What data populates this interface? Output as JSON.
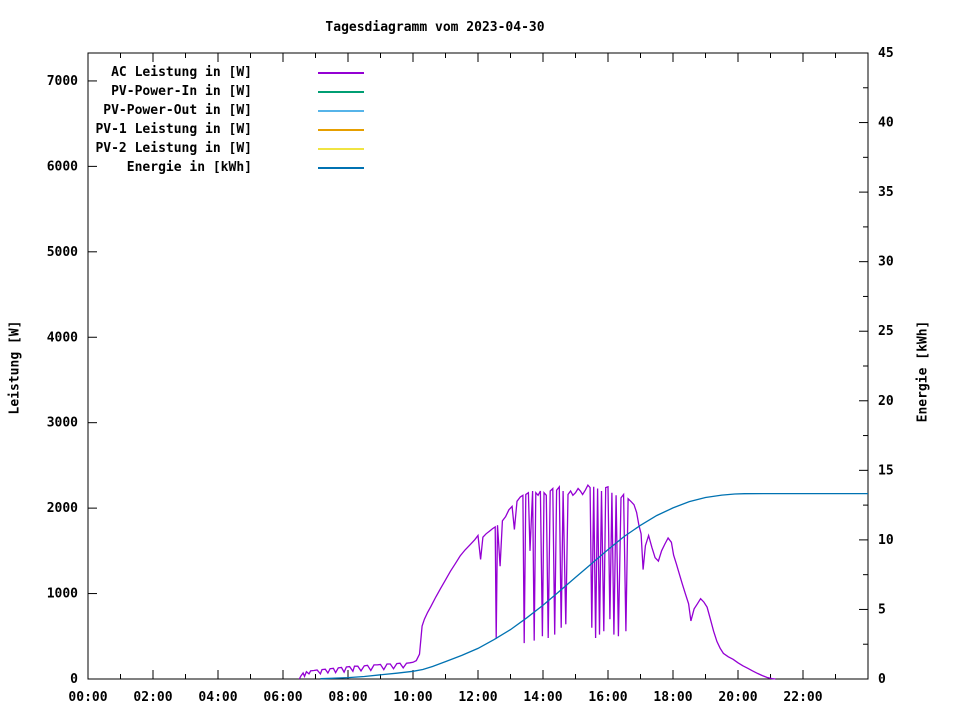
{
  "chart_data": {
    "type": "line",
    "title": "Tagesdiagramm vom 2023-04-30",
    "xlabel": "",
    "ylabel_left": "Leistung [W]",
    "ylabel_right": "Energie [kWh]",
    "legend_position": "top-left-inside",
    "grid": false,
    "x_axis": {
      "min_hours": 0,
      "max_hours": 24,
      "major_step_hours": 2,
      "minor_step_hours": 1,
      "tick_labels": [
        "00:00",
        "02:00",
        "04:00",
        "06:00",
        "08:00",
        "10:00",
        "12:00",
        "14:00",
        "16:00",
        "18:00",
        "20:00",
        "22:00"
      ]
    },
    "y_left_axis": {
      "min": 0,
      "max": 7327,
      "tick_step": 1000,
      "tick_labels": [
        "0",
        "1000",
        "2000",
        "3000",
        "4000",
        "5000",
        "6000",
        "7000"
      ]
    },
    "y_right_axis": {
      "min": 0,
      "max": 45,
      "major_step": 5,
      "minor_step": 2.5,
      "tick_labels": [
        "0",
        "5",
        "10",
        "15",
        "20",
        "25",
        "30",
        "35",
        "40",
        "45"
      ]
    },
    "series": [
      {
        "name": "AC Leistung in [W]",
        "color": "#9400D3",
        "axis": "left",
        "points": [
          [
            6.5,
            0
          ],
          [
            6.55,
            35
          ],
          [
            6.62,
            70
          ],
          [
            6.66,
            30
          ],
          [
            6.72,
            85
          ],
          [
            6.8,
            60
          ],
          [
            6.85,
            95
          ],
          [
            6.95,
            100
          ],
          [
            7.05,
            105
          ],
          [
            7.15,
            60
          ],
          [
            7.2,
            110
          ],
          [
            7.3,
            115
          ],
          [
            7.38,
            70
          ],
          [
            7.45,
            120
          ],
          [
            7.55,
            125
          ],
          [
            7.62,
            75
          ],
          [
            7.7,
            130
          ],
          [
            7.8,
            135
          ],
          [
            7.88,
            80
          ],
          [
            7.95,
            140
          ],
          [
            8.05,
            145
          ],
          [
            8.15,
            90
          ],
          [
            8.2,
            150
          ],
          [
            8.3,
            150
          ],
          [
            8.4,
            95
          ],
          [
            8.5,
            155
          ],
          [
            8.6,
            160
          ],
          [
            8.7,
            100
          ],
          [
            8.8,
            165
          ],
          [
            8.9,
            165
          ],
          [
            9.0,
            170
          ],
          [
            9.1,
            110
          ],
          [
            9.2,
            175
          ],
          [
            9.3,
            175
          ],
          [
            9.4,
            120
          ],
          [
            9.5,
            180
          ],
          [
            9.6,
            185
          ],
          [
            9.7,
            130
          ],
          [
            9.8,
            185
          ],
          [
            9.9,
            190
          ],
          [
            10.0,
            195
          ],
          [
            10.1,
            215
          ],
          [
            10.2,
            290
          ],
          [
            10.28,
            620
          ],
          [
            10.35,
            700
          ],
          [
            10.45,
            780
          ],
          [
            10.55,
            850
          ],
          [
            10.7,
            960
          ],
          [
            10.85,
            1060
          ],
          [
            11.0,
            1160
          ],
          [
            11.15,
            1260
          ],
          [
            11.3,
            1350
          ],
          [
            11.45,
            1440
          ],
          [
            11.6,
            1510
          ],
          [
            11.75,
            1570
          ],
          [
            11.9,
            1630
          ],
          [
            12.0,
            1680
          ],
          [
            12.08,
            1400
          ],
          [
            12.15,
            1660
          ],
          [
            12.25,
            1700
          ],
          [
            12.35,
            1730
          ],
          [
            12.45,
            1760
          ],
          [
            12.53,
            1780
          ],
          [
            12.56,
            470
          ],
          [
            12.6,
            1800
          ],
          [
            12.68,
            1320
          ],
          [
            12.75,
            1850
          ],
          [
            12.85,
            1900
          ],
          [
            12.95,
            1980
          ],
          [
            13.05,
            2020
          ],
          [
            13.12,
            1750
          ],
          [
            13.2,
            2080
          ],
          [
            13.3,
            2130
          ],
          [
            13.38,
            2150
          ],
          [
            13.42,
            420
          ],
          [
            13.47,
            2160
          ],
          [
            13.55,
            2180
          ],
          [
            13.6,
            1500
          ],
          [
            13.68,
            2200
          ],
          [
            13.73,
            450
          ],
          [
            13.78,
            2180
          ],
          [
            13.85,
            2150
          ],
          [
            13.92,
            2200
          ],
          [
            13.98,
            500
          ],
          [
            14.03,
            2180
          ],
          [
            14.1,
            2150
          ],
          [
            14.16,
            480
          ],
          [
            14.22,
            2200
          ],
          [
            14.3,
            2230
          ],
          [
            14.36,
            520
          ],
          [
            14.42,
            2210
          ],
          [
            14.5,
            2250
          ],
          [
            14.56,
            600
          ],
          [
            14.62,
            2200
          ],
          [
            14.7,
            640
          ],
          [
            14.77,
            2160
          ],
          [
            14.85,
            2200
          ],
          [
            14.92,
            2150
          ],
          [
            15.0,
            2180
          ],
          [
            15.08,
            2230
          ],
          [
            15.15,
            2200
          ],
          [
            15.22,
            2160
          ],
          [
            15.3,
            2210
          ],
          [
            15.38,
            2270
          ],
          [
            15.45,
            2240
          ],
          [
            15.5,
            600
          ],
          [
            15.56,
            2250
          ],
          [
            15.62,
            480
          ],
          [
            15.68,
            2230
          ],
          [
            15.74,
            520
          ],
          [
            15.8,
            2200
          ],
          [
            15.87,
            560
          ],
          [
            15.93,
            2240
          ],
          [
            16.0,
            2250
          ],
          [
            16.06,
            700
          ],
          [
            16.12,
            2180
          ],
          [
            16.18,
            520
          ],
          [
            16.25,
            2150
          ],
          [
            16.32,
            500
          ],
          [
            16.4,
            2120
          ],
          [
            16.48,
            2160
          ],
          [
            16.55,
            560
          ],
          [
            16.62,
            2110
          ],
          [
            16.7,
            2080
          ],
          [
            16.8,
            2040
          ],
          [
            16.88,
            1950
          ],
          [
            16.95,
            1800
          ],
          [
            17.02,
            1700
          ],
          [
            17.08,
            1280
          ],
          [
            17.15,
            1560
          ],
          [
            17.25,
            1680
          ],
          [
            17.35,
            1540
          ],
          [
            17.45,
            1420
          ],
          [
            17.55,
            1380
          ],
          [
            17.65,
            1500
          ],
          [
            17.75,
            1580
          ],
          [
            17.85,
            1650
          ],
          [
            17.95,
            1600
          ],
          [
            18.02,
            1450
          ],
          [
            18.1,
            1350
          ],
          [
            18.18,
            1250
          ],
          [
            18.28,
            1120
          ],
          [
            18.38,
            1000
          ],
          [
            18.48,
            880
          ],
          [
            18.55,
            680
          ],
          [
            18.65,
            820
          ],
          [
            18.75,
            880
          ],
          [
            18.85,
            940
          ],
          [
            18.95,
            900
          ],
          [
            19.05,
            840
          ],
          [
            19.15,
            700
          ],
          [
            19.25,
            560
          ],
          [
            19.35,
            440
          ],
          [
            19.45,
            360
          ],
          [
            19.55,
            300
          ],
          [
            19.7,
            260
          ],
          [
            19.85,
            230
          ],
          [
            20.0,
            190
          ],
          [
            20.15,
            155
          ],
          [
            20.3,
            125
          ],
          [
            20.45,
            95
          ],
          [
            20.6,
            65
          ],
          [
            20.75,
            40
          ],
          [
            20.9,
            18
          ],
          [
            21.05,
            5
          ],
          [
            21.15,
            0
          ]
        ]
      },
      {
        "name": "PV-Power-In in [W]",
        "color": "#009E73",
        "axis": "left",
        "points": []
      },
      {
        "name": "PV-Power-Out in [W]",
        "color": "#56B4E9",
        "axis": "left",
        "points": []
      },
      {
        "name": "PV-1 Leistung in [W]",
        "color": "#E69F00",
        "axis": "left",
        "points": []
      },
      {
        "name": "PV-2 Leistung in [W]",
        "color": "#F0E442",
        "axis": "left",
        "points": []
      },
      {
        "name": "Energie in [kWh]",
        "color": "#0072B2",
        "axis": "right",
        "points": [
          [
            7.15,
            0.02
          ],
          [
            7.5,
            0.05
          ],
          [
            8.0,
            0.1
          ],
          [
            8.5,
            0.18
          ],
          [
            9.0,
            0.3
          ],
          [
            9.5,
            0.42
          ],
          [
            10.0,
            0.55
          ],
          [
            10.3,
            0.68
          ],
          [
            10.6,
            0.9
          ],
          [
            11.0,
            1.25
          ],
          [
            11.5,
            1.7
          ],
          [
            12.0,
            2.2
          ],
          [
            12.5,
            2.85
          ],
          [
            13.0,
            3.55
          ],
          [
            13.5,
            4.4
          ],
          [
            14.0,
            5.3
          ],
          [
            14.5,
            6.3
          ],
          [
            15.0,
            7.3
          ],
          [
            15.5,
            8.3
          ],
          [
            16.0,
            9.3
          ],
          [
            16.5,
            10.25
          ],
          [
            17.0,
            11.05
          ],
          [
            17.5,
            11.75
          ],
          [
            18.0,
            12.3
          ],
          [
            18.5,
            12.75
          ],
          [
            19.0,
            13.05
          ],
          [
            19.5,
            13.22
          ],
          [
            19.9,
            13.3
          ],
          [
            20.2,
            13.32
          ],
          [
            21.0,
            13.33
          ],
          [
            22.0,
            13.33
          ],
          [
            23.0,
            13.33
          ],
          [
            24.0,
            13.33
          ]
        ]
      }
    ]
  }
}
